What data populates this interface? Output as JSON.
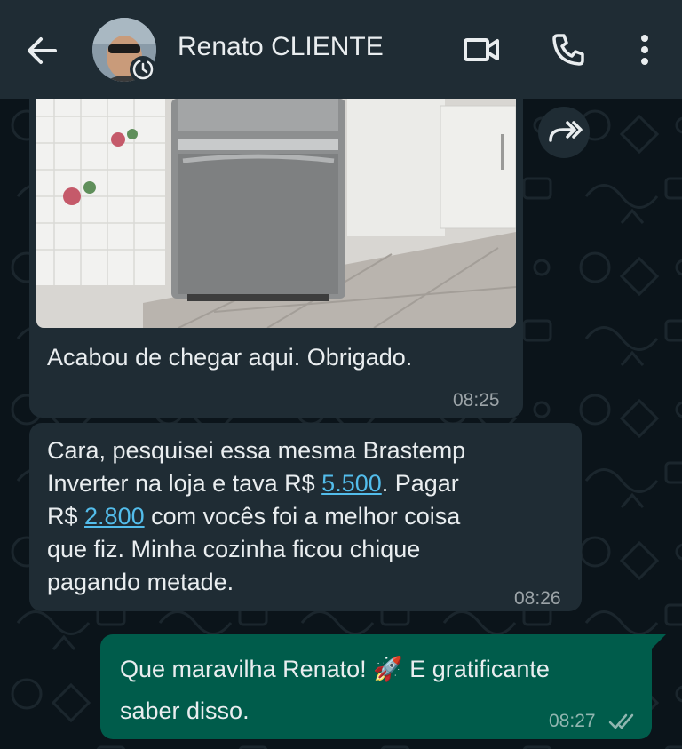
{
  "header": {
    "contact_name": "Renato CLIENTE"
  },
  "icons": {
    "back": "arrow-left-icon",
    "video": "video-call-icon",
    "voice": "phone-icon",
    "menu": "more-vertical-icon",
    "forward": "forward-icon",
    "status": "clock-status-icon",
    "read": "double-check-icon"
  },
  "messages": [
    {
      "direction": "incoming",
      "type": "image",
      "caption": "Acabou de chegar aqui. Obrigado.",
      "time": "08:25"
    },
    {
      "direction": "incoming",
      "type": "text",
      "line1": "Cara, pesquisei essa mesma Brastemp",
      "line2_a": "Inverter na loja e tava R$ ",
      "line2_link": "5.500",
      "line2_b": ". Pagar",
      "line3_a": "R$ ",
      "line3_link": "2.800",
      "line3_b": " com vocês foi a melhor coisa",
      "line4": "que fiz. Minha cozinha ficou chique",
      "line5": "pagando metade.",
      "time": "08:26"
    },
    {
      "direction": "outgoing",
      "type": "text",
      "line1_a": "Que maravilha Renato! ",
      "emoji": "🚀",
      "line1_b": " E gratificante",
      "line2": "saber disso.",
      "time": "08:27"
    }
  ],
  "colors": {
    "background": "#0b141a",
    "header": "#1f2c34",
    "incoming_bubble": "#1f2c34",
    "outgoing_bubble": "#005c4b",
    "link": "#53bdeb"
  }
}
